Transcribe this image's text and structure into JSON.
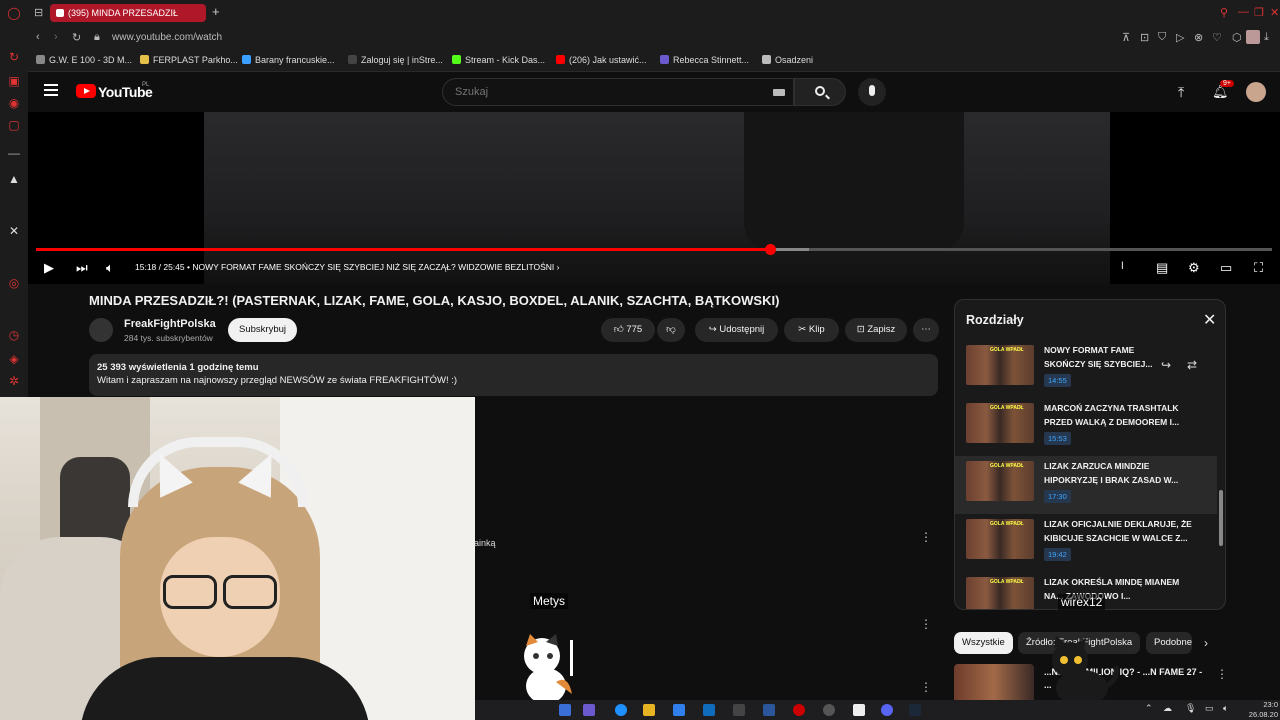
{
  "browser": {
    "tab_title": "(395) MINDA PRZESADZIŁ",
    "new_tab": "+",
    "url": "www.youtube.com/watch",
    "bookmarks": [
      {
        "label": "G.W. E 100 - 3D M...",
        "color": "#888888"
      },
      {
        "label": "FERPLAST Parkho...",
        "color": "#e6c14a"
      },
      {
        "label": "Barany francuskie...",
        "color": "#3aa0ff"
      },
      {
        "label": "Zaloguj się | inStre...",
        "color": "#444444"
      },
      {
        "label": "Stream - Kick Das...",
        "color": "#53fc18"
      },
      {
        "label": "(206) Jak ustawić...",
        "color": "#ff0000"
      },
      {
        "label": "Rebecca Stinnett...",
        "color": "#6a5acd"
      },
      {
        "label": "Osadzeni",
        "color": "#bbbbbb"
      }
    ]
  },
  "youtube": {
    "wordmark": "YouTube",
    "region": "PL",
    "search_placeholder": "Szukaj",
    "notification_count": "9+"
  },
  "player": {
    "time": "15:18 / 25:45",
    "chapter_label": "• NOWY FORMAT FAME SKOŃCZY SIĘ SZYBCIEJ NIŻ SIĘ ZACZĄŁ? WIDZOWIE BEZLITOŚNI",
    "chapter_chevron": "›",
    "progress": 0.594,
    "buffered": 0.625
  },
  "video": {
    "title": "MINDA PRZESADZIŁ?! (PASTERNAK, LIZAK, FAME, GOLA, KASJO, BOXDEL, ALANIK, SZACHTA, BĄTKOWSKI)",
    "channel": "FreakFightPolska",
    "subscribers": "284 tys. subskrybentów",
    "subscribe_label": "Subskrybuj",
    "likes": "775",
    "share_label": "Udostępnij",
    "clip_label": "Klip",
    "save_label": "Zapisz",
    "more_label": "⋯",
    "views": "25 393 wyświetlenia  1 godzinę temu",
    "description": "Witam i zapraszam na najnowszy przegląd NEWSÓW ze świata FREAKFIGHTÓW! :)"
  },
  "comments": {
    "fragment": "ainką"
  },
  "chapters": {
    "title": "Rozdziały",
    "thumb_caption": "GOLA WPADŁ",
    "items": [
      {
        "title": "NOWY FORMAT FAME SKOŃCZY SIĘ SZYBCIEJ...",
        "time": "14:55"
      },
      {
        "title": "MARCOŃ ZACZYNA TRASHTALK PRZED WALKĄ Z DEMOOREM I...",
        "time": "15:53"
      },
      {
        "title": "LIZAK ZARZUCA MINDZIE HIPOKRYZJĘ I BRAK ZASAD W...",
        "time": "17:30"
      },
      {
        "title": "LIZAK OFICJALNIE DEKLARUJE, ŻE KIBICUJE SZACHCIE W WALCE Z...",
        "time": "19:42"
      },
      {
        "title": "LIZAK OKREŚLA MINDĘ MIANEM NA... ZAWODOWO I...",
        "time": ""
      }
    ]
  },
  "filters": [
    "Wszystkie",
    "Źródło: FreakFightPolska",
    "Podobne"
  ],
  "recommended": {
    "title": "...NIK MA MILION IQ? - ...N FAME 27 - ..."
  },
  "overlays": {
    "viewer_left": "Metys",
    "viewer_right": "wirex12"
  },
  "taskbar": {
    "time": "23:0",
    "date": "26.08.20"
  }
}
